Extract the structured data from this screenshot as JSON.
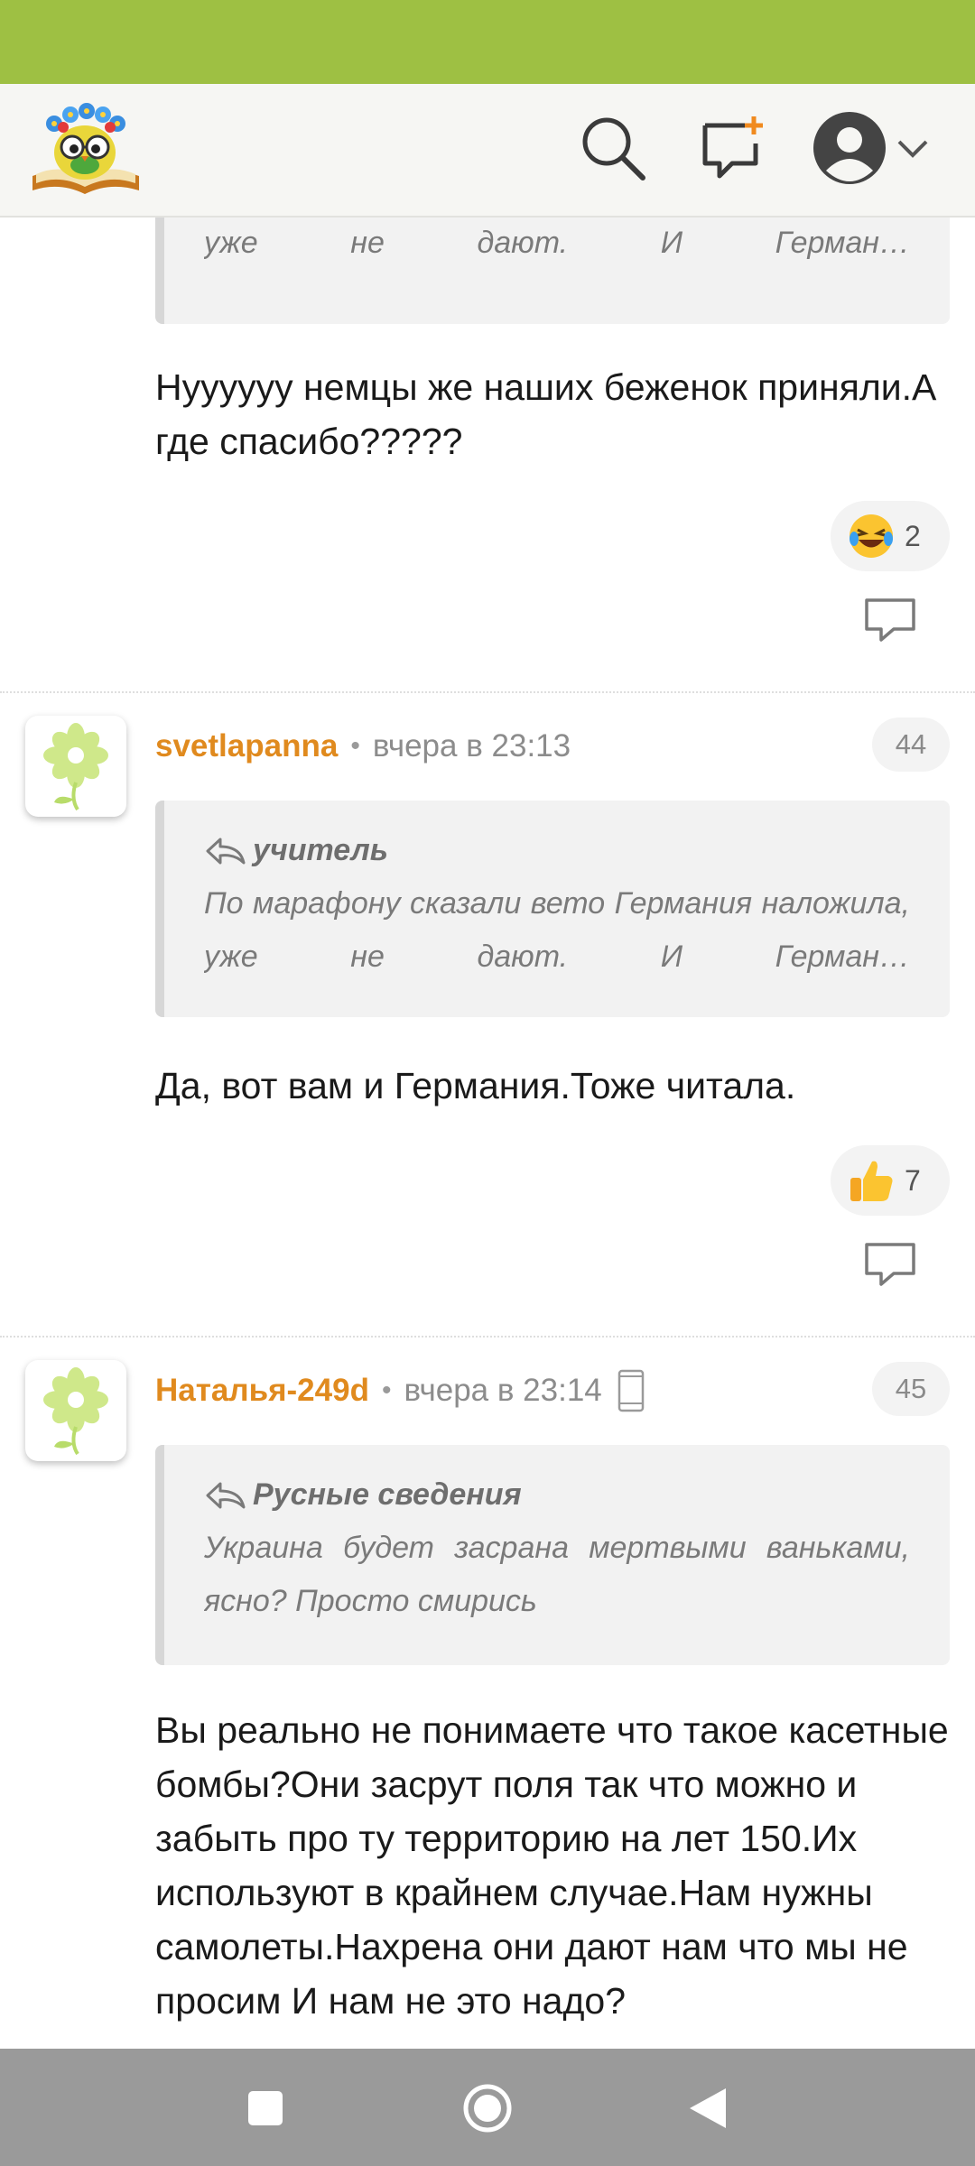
{
  "header": {
    "logo": "owl-reading-book-logo",
    "icons": [
      "search-icon",
      "new-post-icon",
      "user-avatar-icon",
      "chevron-down-icon"
    ]
  },
  "comments": [
    {
      "quote": {
        "author": "",
        "text": "По марафону сказали вето Германия наложила, уже не дают. И Герман…"
      },
      "text": "Нуууууу немцы же наших беженок приняли.А где спасибо?????",
      "reaction": {
        "emoji": "laughing-tears-emoji",
        "count": "2"
      }
    },
    {
      "username": "svetlapanna",
      "time": "вчера в 23:13",
      "number": "44",
      "quote": {
        "author": "учитель",
        "text": "По марафону сказали вето Германия наложила, уже не дают. И Герман…"
      },
      "text": "Да, вот вам и Германия.Тоже читала.",
      "reaction": {
        "emoji": "thumbs-up-emoji",
        "count": "7"
      }
    },
    {
      "username": "Наталья-249d",
      "time": "вчера в 23:14",
      "number": "45",
      "device": "mobile-phone-icon",
      "quote": {
        "author": "Русные сведения",
        "text": "Украина будет засрана мертвыми ваньками, ясно? Просто смирись"
      },
      "text": "Вы реально не понимаете что такое касетные бомбы?Они засрут поля так что можно и забыть про ту территорию на лет 150.Их используют в крайнем случае.Нам нужны самолеты.Нахрена они дают нам что мы не просим И нам не это надо?"
    }
  ],
  "colors": {
    "status_bar": "#9ec043",
    "username": "#e08a1e",
    "nav_bar": "#9a9a9a"
  }
}
